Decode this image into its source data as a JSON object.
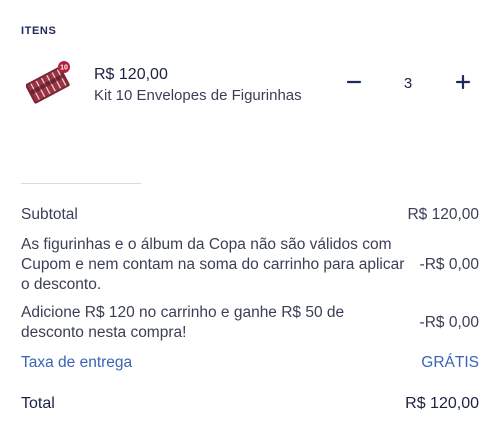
{
  "items_section": {
    "title": "ITENS"
  },
  "item": {
    "price": "R$ 120,00",
    "name": "Kit 10 Envelopes de Figurinhas",
    "quantity": "3",
    "badge": "10"
  },
  "summary": {
    "subtotal_label": "Subtotal",
    "subtotal_value": "R$ 120,00",
    "notice1_label": "As figurinhas e o álbum da Copa não são válidos com Cupom e nem contam na soma do carrinho para aplicar o desconto.",
    "notice1_value": "-R$ 0,00",
    "notice2_label": "Adicione R$ 120 no carrinho e ganhe R$ 50 de desconto nesta compra!",
    "notice2_value": "-R$ 0,00",
    "delivery_label": "Taxa de entrega",
    "delivery_value": "GRÁTIS",
    "total_label": "Total",
    "total_value": "R$ 120,00"
  },
  "colors": {
    "primary": "#1e2a5a",
    "link": "#3a63b8",
    "badge": "#b0223a",
    "product": "#7a2634"
  },
  "icons": {
    "minus": "minus-icon",
    "plus": "plus-icon"
  }
}
